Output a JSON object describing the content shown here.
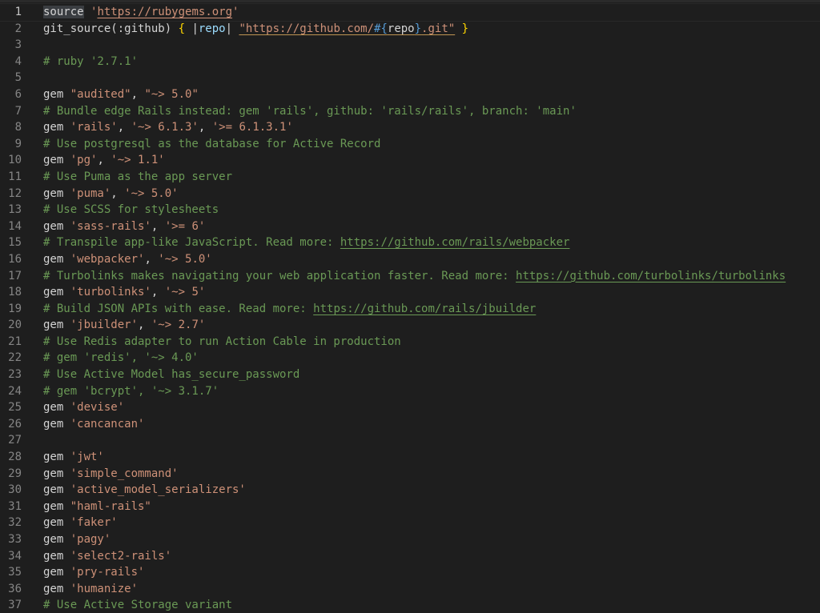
{
  "editor": {
    "language": "ruby",
    "current_line": 1,
    "lines": [
      {
        "n": "1",
        "tokens": [
          {
            "t": "source",
            "c": "t-default t-cursor-word"
          },
          {
            "t": " ",
            "c": "t-default"
          },
          {
            "t": "'",
            "c": "t-str"
          },
          {
            "t": "https://rubygems.org",
            "c": "t-str t-link str"
          },
          {
            "t": "'",
            "c": "t-str"
          }
        ]
      },
      {
        "n": "2",
        "tokens": [
          {
            "t": "git_source(:github) ",
            "c": "t-default"
          },
          {
            "t": "{",
            "c": "t-brace"
          },
          {
            "t": " |",
            "c": "t-default"
          },
          {
            "t": "repo",
            "c": "t-var"
          },
          {
            "t": "| ",
            "c": "t-default"
          },
          {
            "t": "\"https://github.com/",
            "c": "t-str t-squig"
          },
          {
            "t": "#{",
            "c": "t-interp t-squig"
          },
          {
            "t": "repo",
            "c": "t-default t-squig"
          },
          {
            "t": "}",
            "c": "t-interp t-squig"
          },
          {
            "t": ".git\"",
            "c": "t-str t-squig"
          },
          {
            "t": " ",
            "c": "t-default"
          },
          {
            "t": "}",
            "c": "t-brace"
          }
        ]
      },
      {
        "n": "3",
        "tokens": []
      },
      {
        "n": "4",
        "tokens": [
          {
            "t": "# ruby '2.7.1'",
            "c": "t-comment"
          }
        ]
      },
      {
        "n": "5",
        "tokens": []
      },
      {
        "n": "6",
        "tokens": [
          {
            "t": "gem ",
            "c": "t-default"
          },
          {
            "t": "\"audited\"",
            "c": "t-str"
          },
          {
            "t": ", ",
            "c": "t-default"
          },
          {
            "t": "\"~> 5.0\"",
            "c": "t-str"
          }
        ]
      },
      {
        "n": "7",
        "tokens": [
          {
            "t": "# Bundle edge Rails instead: gem 'rails', github: 'rails/rails', branch: 'main'",
            "c": "t-comment"
          }
        ]
      },
      {
        "n": "8",
        "tokens": [
          {
            "t": "gem ",
            "c": "t-default"
          },
          {
            "t": "'rails'",
            "c": "t-str"
          },
          {
            "t": ", ",
            "c": "t-default"
          },
          {
            "t": "'~> 6.1.3'",
            "c": "t-str"
          },
          {
            "t": ", ",
            "c": "t-default"
          },
          {
            "t": "'>= 6.1.3.1'",
            "c": "t-str"
          }
        ]
      },
      {
        "n": "9",
        "tokens": [
          {
            "t": "# Use postgresql as the database for Active Record",
            "c": "t-comment"
          }
        ]
      },
      {
        "n": "10",
        "tokens": [
          {
            "t": "gem ",
            "c": "t-default"
          },
          {
            "t": "'pg'",
            "c": "t-str"
          },
          {
            "t": ", ",
            "c": "t-default"
          },
          {
            "t": "'~> 1.1'",
            "c": "t-str"
          }
        ]
      },
      {
        "n": "11",
        "tokens": [
          {
            "t": "# Use Puma as the app server",
            "c": "t-comment"
          }
        ]
      },
      {
        "n": "12",
        "tokens": [
          {
            "t": "gem ",
            "c": "t-default"
          },
          {
            "t": "'puma'",
            "c": "t-str"
          },
          {
            "t": ", ",
            "c": "t-default"
          },
          {
            "t": "'~> 5.0'",
            "c": "t-str"
          }
        ]
      },
      {
        "n": "13",
        "tokens": [
          {
            "t": "# Use SCSS for stylesheets",
            "c": "t-comment"
          }
        ]
      },
      {
        "n": "14",
        "tokens": [
          {
            "t": "gem ",
            "c": "t-default"
          },
          {
            "t": "'sass-rails'",
            "c": "t-str"
          },
          {
            "t": ", ",
            "c": "t-default"
          },
          {
            "t": "'>= 6'",
            "c": "t-str"
          }
        ]
      },
      {
        "n": "15",
        "tokens": [
          {
            "t": "# Transpile app-like JavaScript. Read more: ",
            "c": "t-comment"
          },
          {
            "t": "https://github.com/rails/webpacker",
            "c": "t-comment t-link"
          }
        ]
      },
      {
        "n": "16",
        "tokens": [
          {
            "t": "gem ",
            "c": "t-default"
          },
          {
            "t": "'webpacker'",
            "c": "t-str"
          },
          {
            "t": ", ",
            "c": "t-default"
          },
          {
            "t": "'~> 5.0'",
            "c": "t-str"
          }
        ]
      },
      {
        "n": "17",
        "tokens": [
          {
            "t": "# Turbolinks makes navigating your web application faster. Read more: ",
            "c": "t-comment"
          },
          {
            "t": "https://github.com/turbolinks/turbolinks",
            "c": "t-comment t-link"
          }
        ]
      },
      {
        "n": "18",
        "tokens": [
          {
            "t": "gem ",
            "c": "t-default"
          },
          {
            "t": "'turbolinks'",
            "c": "t-str"
          },
          {
            "t": ", ",
            "c": "t-default"
          },
          {
            "t": "'~> 5'",
            "c": "t-str"
          }
        ]
      },
      {
        "n": "19",
        "tokens": [
          {
            "t": "# Build JSON APIs with ease. Read more: ",
            "c": "t-comment"
          },
          {
            "t": "https://github.com/rails/jbuilder",
            "c": "t-comment t-link"
          }
        ]
      },
      {
        "n": "20",
        "tokens": [
          {
            "t": "gem ",
            "c": "t-default"
          },
          {
            "t": "'jbuilder'",
            "c": "t-str"
          },
          {
            "t": ", ",
            "c": "t-default"
          },
          {
            "t": "'~> 2.7'",
            "c": "t-str"
          }
        ]
      },
      {
        "n": "21",
        "tokens": [
          {
            "t": "# Use Redis adapter to run Action Cable in production",
            "c": "t-comment"
          }
        ]
      },
      {
        "n": "22",
        "tokens": [
          {
            "t": "# gem 'redis', '~> 4.0'",
            "c": "t-comment"
          }
        ]
      },
      {
        "n": "23",
        "tokens": [
          {
            "t": "# Use Active Model has_secure_password",
            "c": "t-comment"
          }
        ]
      },
      {
        "n": "24",
        "tokens": [
          {
            "t": "# gem 'bcrypt', '~> 3.1.7'",
            "c": "t-comment"
          }
        ]
      },
      {
        "n": "25",
        "tokens": [
          {
            "t": "gem ",
            "c": "t-default"
          },
          {
            "t": "'devise'",
            "c": "t-str"
          }
        ]
      },
      {
        "n": "26",
        "tokens": [
          {
            "t": "gem ",
            "c": "t-default"
          },
          {
            "t": "'cancancan'",
            "c": "t-str"
          }
        ]
      },
      {
        "n": "27",
        "tokens": []
      },
      {
        "n": "28",
        "tokens": [
          {
            "t": "gem ",
            "c": "t-default"
          },
          {
            "t": "'jwt'",
            "c": "t-str"
          }
        ]
      },
      {
        "n": "29",
        "tokens": [
          {
            "t": "gem ",
            "c": "t-default"
          },
          {
            "t": "'simple_command'",
            "c": "t-str"
          }
        ]
      },
      {
        "n": "30",
        "tokens": [
          {
            "t": "gem ",
            "c": "t-default"
          },
          {
            "t": "'active_model_serializers'",
            "c": "t-str"
          }
        ]
      },
      {
        "n": "31",
        "tokens": [
          {
            "t": "gem ",
            "c": "t-default"
          },
          {
            "t": "\"haml-rails\"",
            "c": "t-str"
          }
        ]
      },
      {
        "n": "32",
        "tokens": [
          {
            "t": "gem ",
            "c": "t-default"
          },
          {
            "t": "'faker'",
            "c": "t-str"
          }
        ]
      },
      {
        "n": "33",
        "tokens": [
          {
            "t": "gem ",
            "c": "t-default"
          },
          {
            "t": "'pagy'",
            "c": "t-str"
          }
        ]
      },
      {
        "n": "34",
        "tokens": [
          {
            "t": "gem ",
            "c": "t-default"
          },
          {
            "t": "'select2-rails'",
            "c": "t-str"
          }
        ]
      },
      {
        "n": "35",
        "tokens": [
          {
            "t": "gem ",
            "c": "t-default"
          },
          {
            "t": "'pry-rails'",
            "c": "t-str"
          }
        ]
      },
      {
        "n": "36",
        "tokens": [
          {
            "t": "gem ",
            "c": "t-default"
          },
          {
            "t": "'humanize'",
            "c": "t-str"
          }
        ]
      },
      {
        "n": "37",
        "tokens": [
          {
            "t": "# Use Active Storage variant",
            "c": "t-comment"
          }
        ]
      }
    ]
  }
}
